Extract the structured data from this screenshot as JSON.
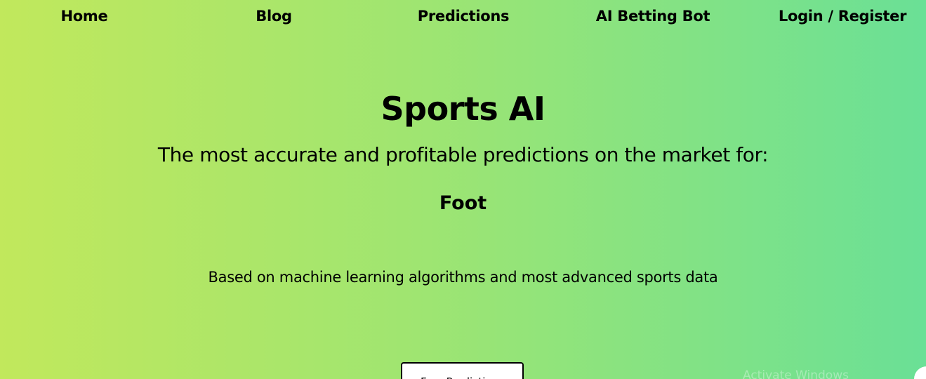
{
  "nav": {
    "home": "Home",
    "blog": "Blog",
    "predictions": "Predictions",
    "bot": "AI Betting Bot",
    "login": "Login / Register"
  },
  "hero": {
    "title": "Sports AI",
    "subtitle": "The most accurate and profitable predictions on the market for:",
    "sport": "Foot",
    "description": "Based on machine learning algorithms and most advanced sports data",
    "cta_label": "Free Predictions"
  },
  "overlay": {
    "watermark": "Activate Windows"
  },
  "colors": {
    "gradient_start": "#c1e85c",
    "gradient_end": "#6ae096",
    "text": "#000000"
  }
}
